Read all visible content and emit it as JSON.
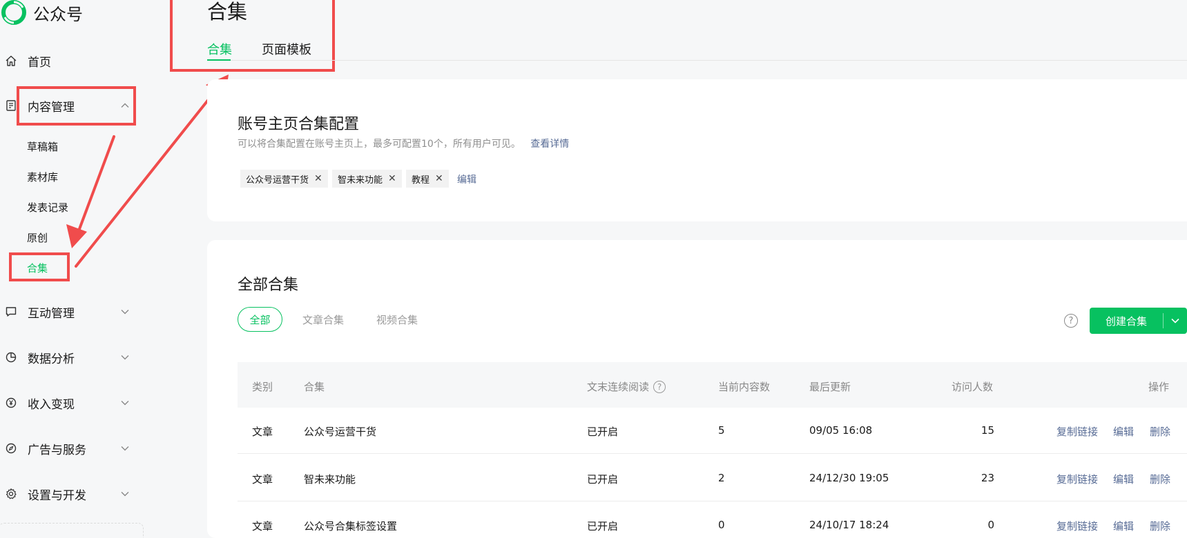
{
  "app": {
    "name": "公众号"
  },
  "sidebar": {
    "items": [
      {
        "label": "首页",
        "icon": "home-icon"
      },
      {
        "label": "内容管理",
        "icon": "document-icon",
        "expanded": true,
        "children": [
          "草稿箱",
          "素材库",
          "发表记录",
          "原创",
          "合集"
        ],
        "active_child": "合集"
      },
      {
        "label": "互动管理",
        "icon": "chat-icon"
      },
      {
        "label": "数据分析",
        "icon": "pie-chart-icon"
      },
      {
        "label": "收入变现",
        "icon": "yen-icon"
      },
      {
        "label": "广告与服务",
        "icon": "compass-icon"
      },
      {
        "label": "设置与开发",
        "icon": "gear-icon"
      }
    ]
  },
  "page": {
    "title": "合集",
    "tabs": [
      "合集",
      "页面模板"
    ],
    "active_tab": "合集"
  },
  "config_card": {
    "title": "账号主页合集配置",
    "description": "可以将合集配置在账号主页上，最多可配置10个，所有用户可见。",
    "detail_link": "查看详情",
    "tags": [
      "公众号运营干货",
      "智未来功能",
      "教程"
    ],
    "edit_link": "编辑"
  },
  "all_card": {
    "title": "全部合集",
    "filters": [
      "全部",
      "文章合集",
      "视频合集"
    ],
    "active_filter": "全部",
    "create_button": "创建合集"
  },
  "table": {
    "headers": [
      "类别",
      "合集",
      "文末连续阅读",
      "当前内容数",
      "最后更新",
      "访问人数",
      "操作"
    ],
    "rows": [
      {
        "type": "文章",
        "name": "公众号运营干货",
        "continuous": "已开启",
        "count": "5",
        "updated": "09/05 16:08",
        "visitors": "15"
      },
      {
        "type": "文章",
        "name": "智未来功能",
        "continuous": "已开启",
        "count": "2",
        "updated": "24/12/30 19:05",
        "visitors": "23"
      },
      {
        "type": "文章",
        "name": "公众号合集标签设置",
        "continuous": "已开启",
        "count": "0",
        "updated": "24/10/17 18:24",
        "visitors": "0"
      }
    ],
    "actions": [
      "复制链接",
      "编辑",
      "删除"
    ]
  },
  "colors": {
    "accent": "#07c160",
    "link": "#576b95",
    "annotation": "#f04c4c"
  }
}
